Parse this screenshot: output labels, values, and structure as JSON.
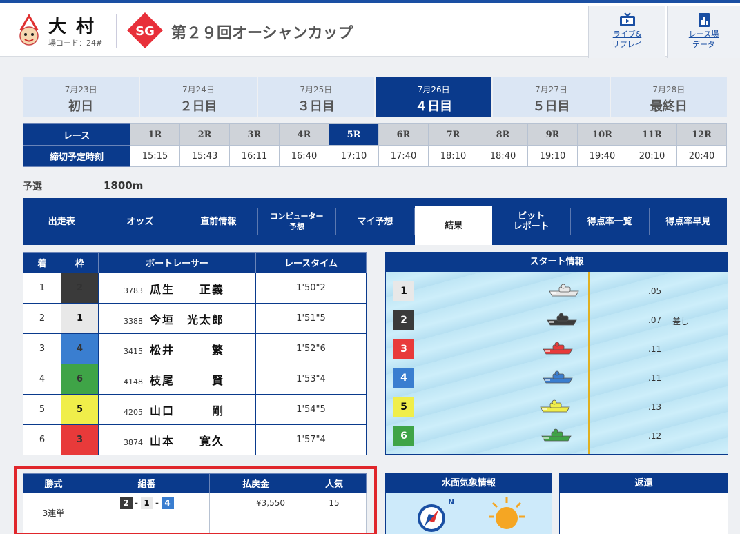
{
  "header": {
    "venue": "大村",
    "venue_code": "場コード：24#",
    "grade_badge": "SG",
    "title": "第２９回オーシャンカップ",
    "links": [
      {
        "label": "ライブ&\nリプレイ",
        "icon": "tv-icon"
      },
      {
        "label": "レース場\nデータ",
        "icon": "data-chart-icon"
      }
    ]
  },
  "days": [
    {
      "date": "7月23日",
      "label": "初日"
    },
    {
      "date": "7月24日",
      "label": "２日目"
    },
    {
      "date": "7月25日",
      "label": "３日目"
    },
    {
      "date": "7月26日",
      "label": "４日目",
      "active": true
    },
    {
      "date": "7月27日",
      "label": "５日目"
    },
    {
      "date": "7月28日",
      "label": "最終日"
    }
  ],
  "race_table": {
    "race_header": "レース",
    "time_header": "締切予定時刻",
    "races": [
      {
        "no": "1R",
        "time": "15:15"
      },
      {
        "no": "2R",
        "time": "15:43"
      },
      {
        "no": "3R",
        "time": "16:11"
      },
      {
        "no": "4R",
        "time": "16:40"
      },
      {
        "no": "5R",
        "time": "17:10",
        "active": true
      },
      {
        "no": "6R",
        "time": "17:40"
      },
      {
        "no": "7R",
        "time": "18:10"
      },
      {
        "no": "8R",
        "time": "18:40"
      },
      {
        "no": "9R",
        "time": "19:10"
      },
      {
        "no": "10R",
        "time": "19:40"
      },
      {
        "no": "11R",
        "time": "20:10"
      },
      {
        "no": "12R",
        "time": "20:40"
      }
    ]
  },
  "race_info": {
    "grade": "予選",
    "distance": "1800m"
  },
  "nav": [
    {
      "label": "出走表"
    },
    {
      "label": "オッズ"
    },
    {
      "label": "直前情報"
    },
    {
      "label": "コンピューター\n予想",
      "small": true
    },
    {
      "label": "マイ予想"
    },
    {
      "label": "結果",
      "active": true
    },
    {
      "label": "ピット\nレポート"
    },
    {
      "label": "得点率一覧"
    },
    {
      "label": "得点率早見"
    }
  ],
  "results": {
    "headers": [
      "着",
      "枠",
      "ボートレーサー",
      "レースタイム"
    ],
    "rows": [
      {
        "place": "1",
        "frame": "2",
        "reg": "3783",
        "name": "瓜生　　正義",
        "time": "1'50\"2"
      },
      {
        "place": "2",
        "frame": "1",
        "reg": "3388",
        "name": "今垣　光太郎",
        "time": "1'51\"5"
      },
      {
        "place": "3",
        "frame": "4",
        "reg": "3415",
        "name": "松井　　　繁",
        "time": "1'52\"6"
      },
      {
        "place": "4",
        "frame": "6",
        "reg": "4148",
        "name": "枝尾　　　賢",
        "time": "1'53\"4"
      },
      {
        "place": "5",
        "frame": "5",
        "reg": "4205",
        "name": "山口　　　剛",
        "time": "1'54\"5"
      },
      {
        "place": "6",
        "frame": "3",
        "reg": "3874",
        "name": "山本　　寛久",
        "time": "1'57\"4"
      }
    ]
  },
  "start_info": {
    "title": "スタート情報",
    "entries": [
      {
        "course": "1",
        "frame": "1",
        "st": ".05",
        "note": ""
      },
      {
        "course": "2",
        "frame": "2",
        "st": ".07",
        "note": "差し"
      },
      {
        "course": "3",
        "frame": "3",
        "st": ".11",
        "note": ""
      },
      {
        "course": "4",
        "frame": "4",
        "st": ".11",
        "note": ""
      },
      {
        "course": "5",
        "frame": "5",
        "st": ".13",
        "note": ""
      },
      {
        "course": "6",
        "frame": "6",
        "st": ".12",
        "note": ""
      }
    ]
  },
  "payout": {
    "headers": [
      "勝式",
      "組番",
      "払戻金",
      "人気"
    ],
    "bet_type": "3連単",
    "combo": [
      "2",
      "1",
      "4"
    ],
    "amount": "¥3,550",
    "popularity": "15"
  },
  "weather": {
    "title": "水面気象情報",
    "compass_label": "N"
  },
  "refund": {
    "title": "返還"
  },
  "colors": {
    "navy": "#0a3a8c",
    "frame1": "#e8e8e8",
    "frame2": "#3a3a3a",
    "frame3": "#e83a3a",
    "frame4": "#3a7ed0",
    "frame5": "#f0ee4a",
    "frame6": "#3fa447",
    "highlight": "#e0262b"
  }
}
